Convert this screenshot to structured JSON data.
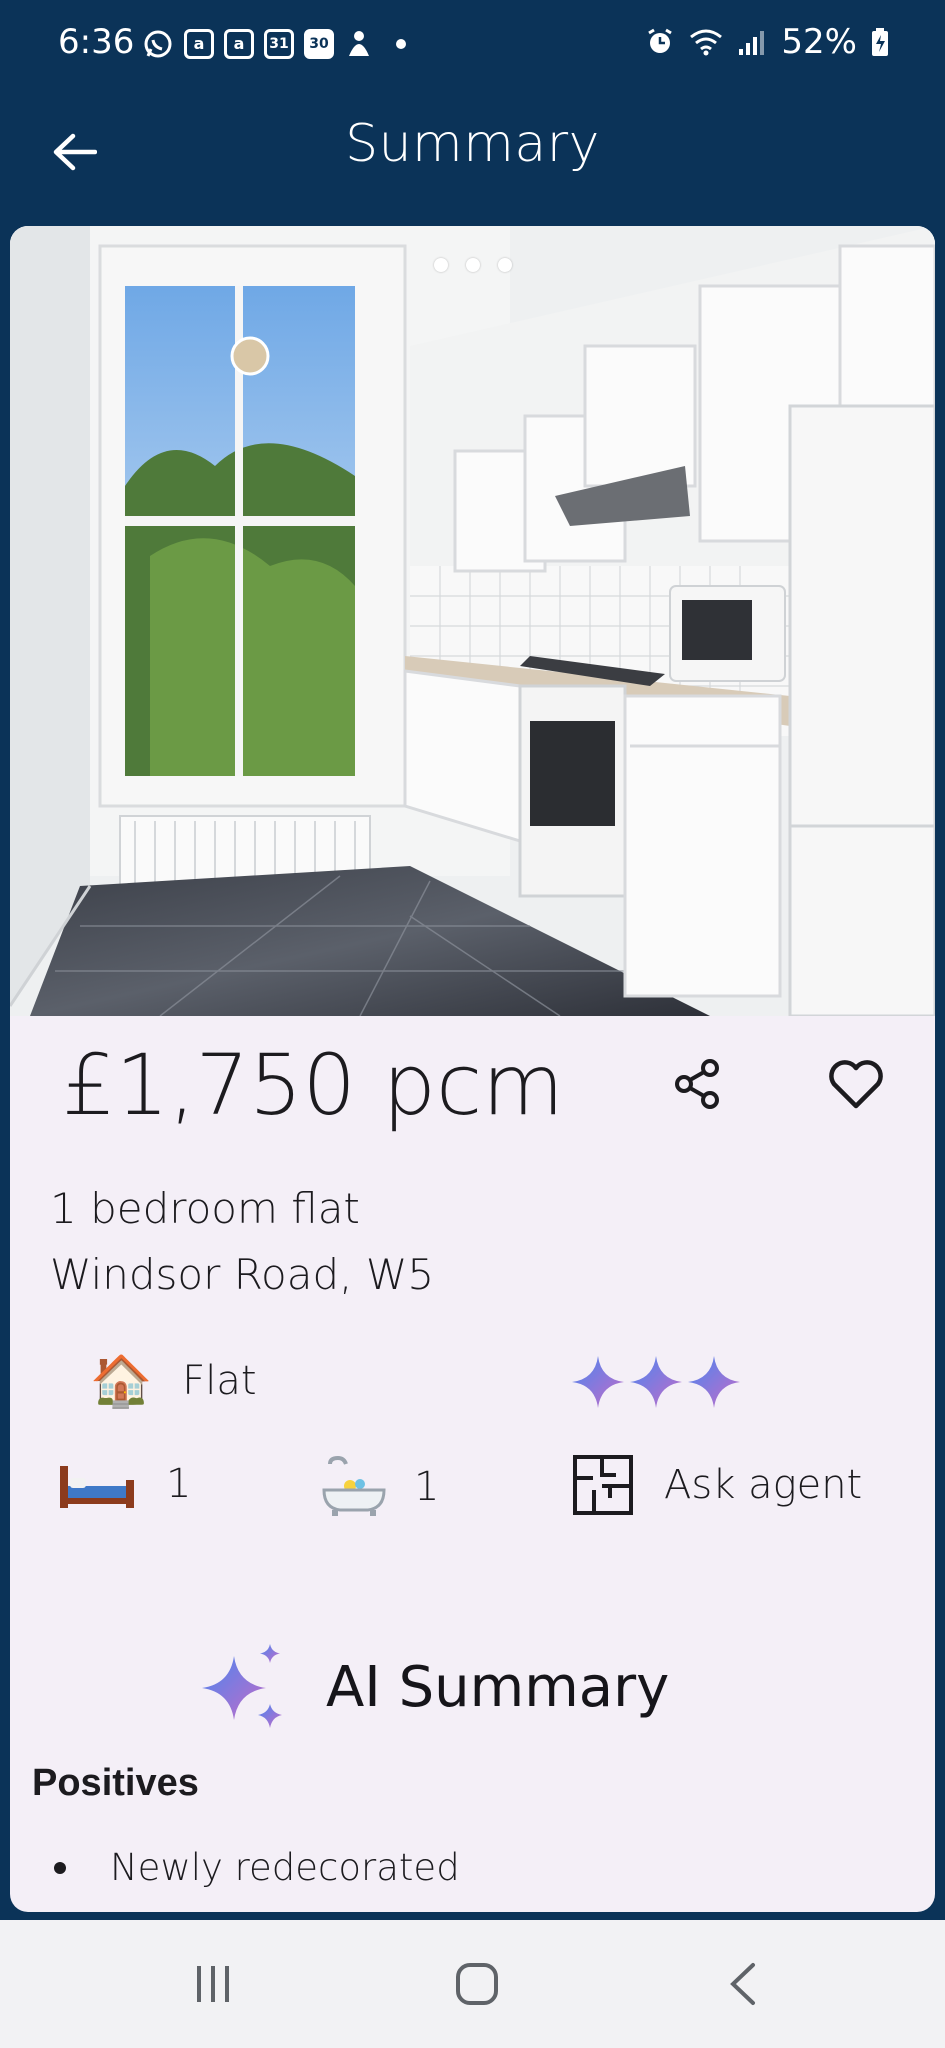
{
  "status_bar": {
    "time": "6:36",
    "notification_icons": [
      "whatsapp-icon",
      "amazon-icon",
      "amazon-icon",
      "calendar-31-icon",
      "calendar-30-icon",
      "app-icon"
    ],
    "notif_amazon": "a",
    "notif_cal31": "31",
    "notif_cal30": "30",
    "battery": "52%"
  },
  "app_bar": {
    "title": "Summary",
    "back_icon": "arrow-left-icon"
  },
  "listing": {
    "photo_pages": 3,
    "price": "£1,750 pcm",
    "type": "1 bedroom flat",
    "address": "Windsor Road, W5",
    "property_kind": "Flat",
    "bedrooms": "1",
    "bathrooms": "1",
    "floorplan_label": "Ask agent"
  },
  "ai_summary": {
    "title": "AI Summary",
    "positives_heading": "Positives",
    "positives": [
      "Newly redecorated"
    ]
  },
  "colors": {
    "header": "#0b3358",
    "card_bg": "#f4eff7",
    "sparkle_start": "#5b8def",
    "sparkle_end": "#c46cc8"
  }
}
